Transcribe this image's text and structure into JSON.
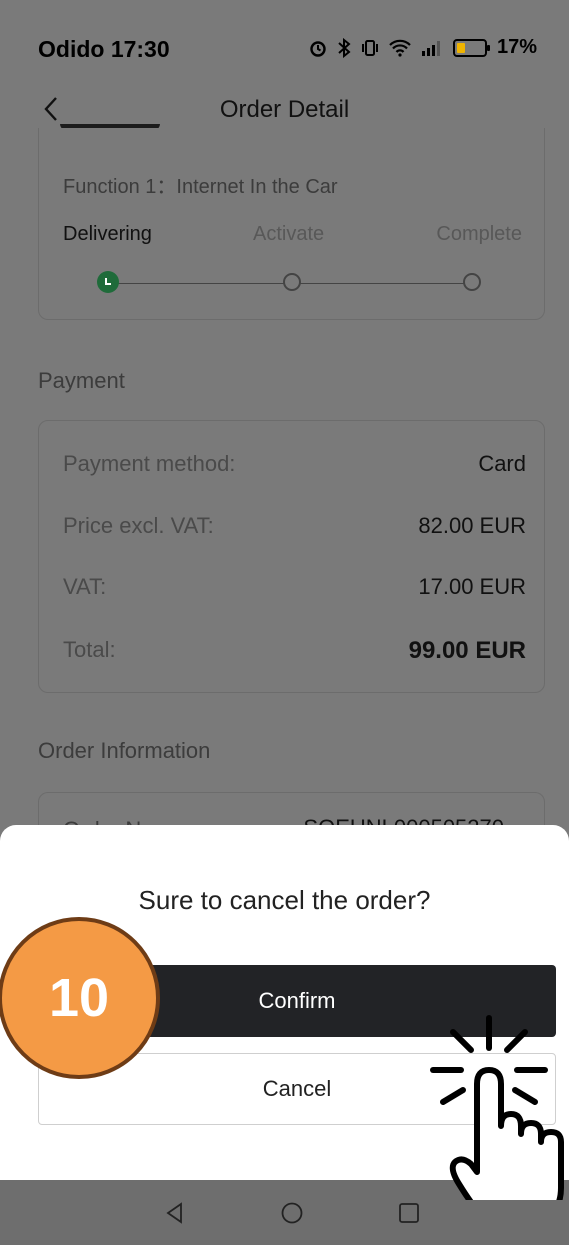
{
  "status": {
    "carrier_time": "Odido 17:30",
    "battery": "17%"
  },
  "header": {
    "title": "Order Detail"
  },
  "function_card": {
    "title": "Function 1：Internet In the Car",
    "steps": [
      "Delivering",
      "Activate",
      "Complete"
    ],
    "current_step": 1
  },
  "payment": {
    "section_title": "Payment",
    "rows": [
      {
        "label": "Payment method:",
        "value": "Card"
      },
      {
        "label": "Price excl. VAT:",
        "value": "82.00 EUR"
      },
      {
        "label": "VAT:",
        "value": "17.00 EUR"
      },
      {
        "label": "Total:",
        "value": "99.00 EUR"
      }
    ]
  },
  "order_info": {
    "section_title": "Order Information",
    "partial_label": "Order N",
    "partial_value": "SOEUNL000505270"
  },
  "dialog": {
    "title": "Sure to cancel the order?",
    "confirm": "Confirm",
    "cancel": "Cancel"
  },
  "overlay": {
    "step_number": "10"
  },
  "colors": {
    "accent_green": "#1f6b3a",
    "badge_orange": "#f49a45",
    "confirm_bg": "#222326"
  }
}
